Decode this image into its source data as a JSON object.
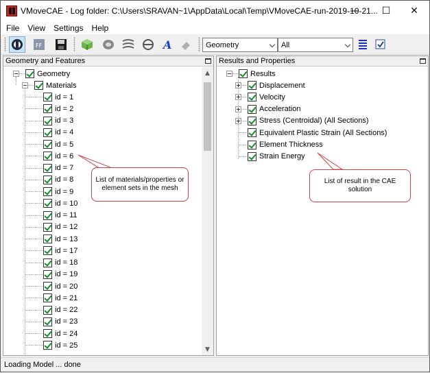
{
  "window": {
    "title": "VMoveCAE - Log folder: C:\\Users\\SRAVAN~1\\AppData\\Local\\Temp\\VMoveCAE-run-2019-10-21...",
    "minimize_glyph": "—",
    "maximize_glyph": "☐",
    "close_glyph": "✕"
  },
  "menu": [
    "File",
    "View",
    "Settings",
    "Help"
  ],
  "toolbar": {
    "geometry_combo": "Geometry",
    "filter_combo": "All"
  },
  "left_panel": {
    "header": "Geometry and Features",
    "root_label": "Geometry",
    "group_label": "Materials",
    "items": [
      "id = 1",
      "id = 2",
      "id = 3",
      "id = 4",
      "id = 5",
      "id = 6",
      "id = 7",
      "id = 8",
      "id = 9",
      "id = 10",
      "id = 11",
      "id = 12",
      "id = 13",
      "id = 17",
      "id = 18",
      "id = 19",
      "id = 20",
      "id = 21",
      "id = 22",
      "id = 23",
      "id = 24",
      "id = 25"
    ]
  },
  "right_panel": {
    "header": "Results and Properties",
    "root_label": "Results",
    "items": [
      {
        "label": "Displacement",
        "expandable": true
      },
      {
        "label": "Velocity",
        "expandable": true
      },
      {
        "label": "Acceleration",
        "expandable": true
      },
      {
        "label": "Stress (Centroidal) (All Sections)",
        "expandable": true
      },
      {
        "label": "Equivalent Plastic Strain (All Sections)",
        "expandable": false
      },
      {
        "label": "Element Thickness",
        "expandable": false
      },
      {
        "label": "Strain Energy",
        "expandable": false
      }
    ]
  },
  "callouts": {
    "left": "List of materials/properties or element sets in the mesh",
    "right": "List of result in the CAE solution"
  },
  "status": "Loading Model ... done",
  "colors": {
    "check": "#118a28",
    "callout_border": "#d04040",
    "accent_text_a": "#1a3ad4"
  }
}
